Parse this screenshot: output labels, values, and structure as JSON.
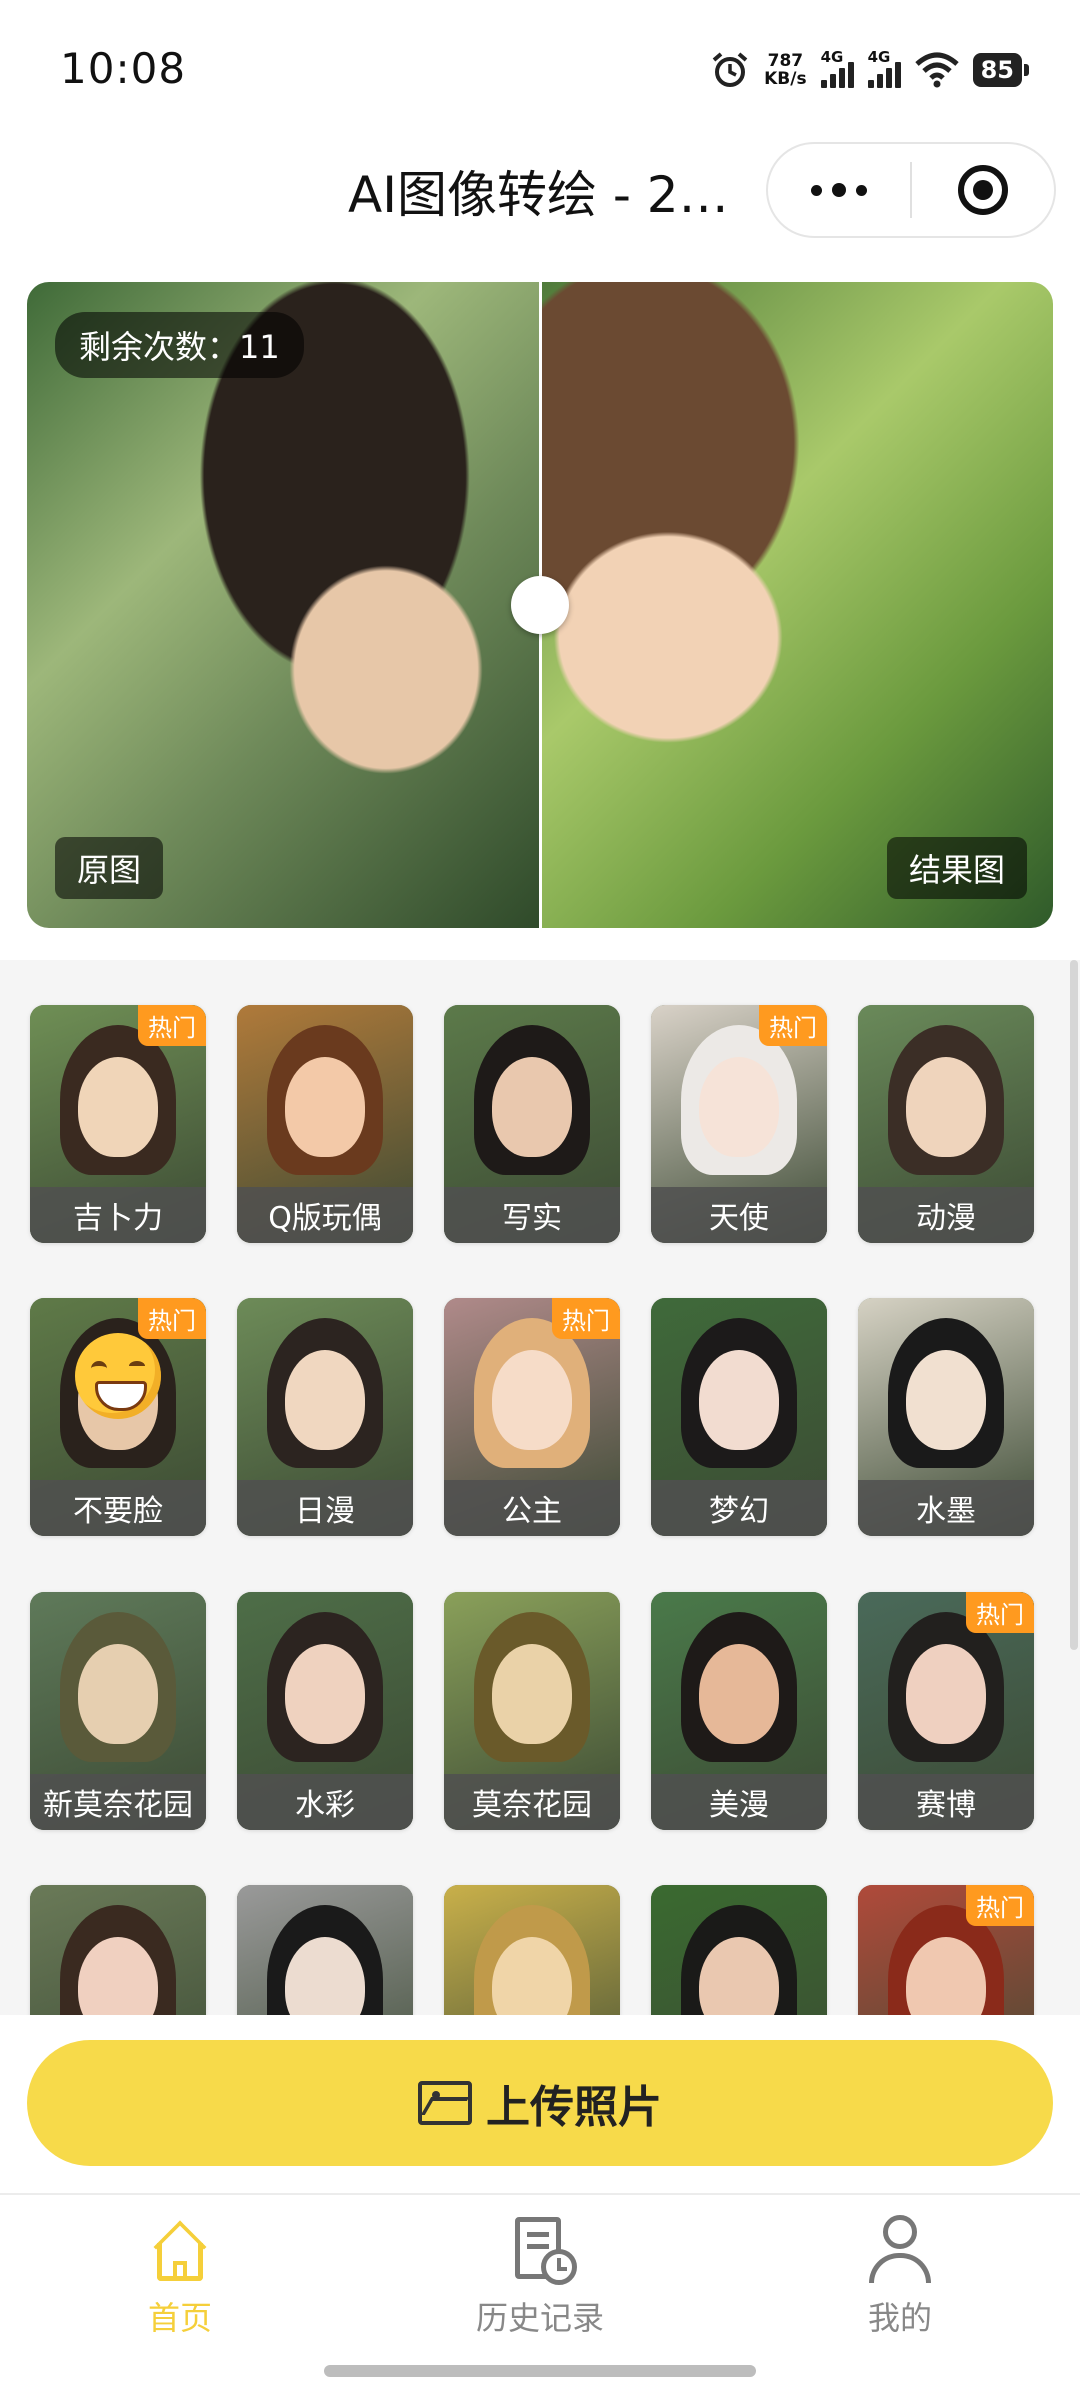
{
  "status_bar": {
    "time": "10:08",
    "net_speed_value": "787",
    "net_speed_unit": "KB/s",
    "sim1_label": "4G",
    "sim2_label": "4G",
    "battery": "85",
    "icons": [
      "alarm-icon",
      "signal-icon",
      "signal-icon",
      "wifi-icon",
      "battery-icon"
    ]
  },
  "nav": {
    "title": "AI图像转绘 - 2…",
    "more_icon": "more-dots-icon",
    "close_icon": "target-close-icon"
  },
  "compare": {
    "remaining_label": "剩余次数：11",
    "original_label": "原图",
    "result_label": "结果图"
  },
  "styles": [
    {
      "label": "吉卜力",
      "hot": true,
      "hot_label": "热门",
      "hair": "#3a2a20",
      "skin": "#f0d5b8",
      "bg": "#6f8f55"
    },
    {
      "label": "Q版玩偶",
      "hot": false,
      "hot_label": "",
      "hair": "#6a3a1e",
      "skin": "#f3c9a8",
      "bg": "#b07a3a"
    },
    {
      "label": "写实",
      "hot": false,
      "hot_label": "",
      "hair": "#1e1a18",
      "skin": "#e9c8ae",
      "bg": "#5c7a4a"
    },
    {
      "label": "天使",
      "hot": true,
      "hot_label": "热门",
      "hair": "#ece9e6",
      "skin": "#f6e3d8",
      "bg": "#d9d2c8"
    },
    {
      "label": "动漫",
      "hot": false,
      "hot_label": "",
      "hair": "#3b2e26",
      "skin": "#efd4bc",
      "bg": "#6a8a5a"
    },
    {
      "label": "不要脸",
      "hot": true,
      "hot_label": "热门",
      "hair": "#2a221c",
      "skin": "#e7c7a8",
      "bg": "#5f7a48",
      "emoji": true
    },
    {
      "label": "日漫",
      "hot": false,
      "hot_label": "",
      "hair": "#2c2420",
      "skin": "#f0d7c0",
      "bg": "#6d8b58"
    },
    {
      "label": "公主",
      "hot": true,
      "hot_label": "热门",
      "hair": "#e0b07a",
      "skin": "#f6dcc8",
      "bg": "#b08a8a"
    },
    {
      "label": "梦幻",
      "hot": false,
      "hot_label": "",
      "hair": "#1c1a1a",
      "skin": "#f2dcd0",
      "bg": "#3f6a3a"
    },
    {
      "label": "水墨",
      "hot": false,
      "hot_label": "",
      "hair": "#1a1a1a",
      "skin": "#f1e0d0",
      "bg": "#d6d2c4"
    },
    {
      "label": "新莫奈花园",
      "hot": false,
      "hot_label": "",
      "hair": "#5a5a3a",
      "skin": "#e6cfb0",
      "bg": "#5f7a5a"
    },
    {
      "label": "水彩",
      "hot": false,
      "hot_label": "",
      "hair": "#2c2420",
      "skin": "#efd2bf",
      "bg": "#4e6e48"
    },
    {
      "label": "莫奈花园",
      "hot": false,
      "hot_label": "",
      "hair": "#6a5a2a",
      "skin": "#ead2a8",
      "bg": "#8aa05a"
    },
    {
      "label": "美漫",
      "hot": false,
      "hot_label": "",
      "hair": "#1e1a18",
      "skin": "#e6b898",
      "bg": "#4a7a4a"
    },
    {
      "label": "赛博",
      "hot": true,
      "hot_label": "热门",
      "hair": "#22201e",
      "skin": "#efd0c0",
      "bg": "#4a6a5a"
    },
    {
      "label": "",
      "hot": false,
      "hot_label": "",
      "hair": "#3a2a20",
      "skin": "#f0d0c0",
      "bg": "#6a7a58"
    },
    {
      "label": "",
      "hot": false,
      "hot_label": "",
      "hair": "#1a1a1a",
      "skin": "#ecdcd0",
      "bg": "#9a9a9a"
    },
    {
      "label": "",
      "hot": false,
      "hot_label": "",
      "hair": "#c09a4a",
      "skin": "#f0d5a8",
      "bg": "#c9b04a"
    },
    {
      "label": "",
      "hot": false,
      "hot_label": "",
      "hair": "#1a1a18",
      "skin": "#eac8b0",
      "bg": "#3a6a30"
    },
    {
      "label": "",
      "hot": true,
      "hot_label": "热门",
      "hair": "#8a2a1a",
      "skin": "#f0c8b0",
      "bg": "#b04a3a"
    }
  ],
  "upload": {
    "label": "上传照片",
    "icon": "image-upload-icon"
  },
  "tabbar": {
    "home_label": "首页",
    "history_label": "历史记录",
    "mine_label": "我的",
    "active": "home",
    "active_color": "#f5cf3a",
    "inactive_color": "#888888"
  }
}
